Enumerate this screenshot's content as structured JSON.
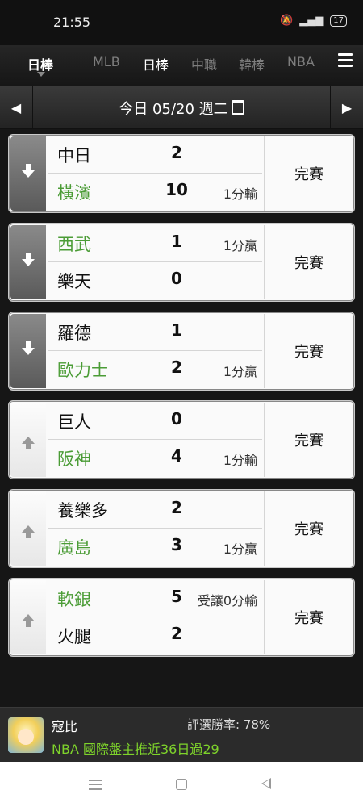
{
  "status_bar": {
    "time": "21:55",
    "battery": "17"
  },
  "league_tabs": {
    "current": "日棒",
    "items": [
      "MLB",
      "日棒",
      "中職",
      "韓棒",
      "NBA"
    ]
  },
  "date_bar": {
    "left_arrow": "◀",
    "right_arrow": "▶",
    "text": "今日 05/20 週二"
  },
  "games": [
    {
      "handle": "down",
      "home_team": "中日",
      "home_score": "2",
      "home_note": "",
      "home_highlight": false,
      "away_team": "橫濱",
      "away_score": "10",
      "away_note": "1分輸",
      "away_highlight": true,
      "status": "完賽"
    },
    {
      "handle": "down",
      "home_team": "西武",
      "home_score": "1",
      "home_note": "1分贏",
      "home_highlight": true,
      "away_team": "樂天",
      "away_score": "0",
      "away_note": "",
      "away_highlight": false,
      "status": "完賽"
    },
    {
      "handle": "down",
      "home_team": "羅德",
      "home_score": "1",
      "home_note": "",
      "home_highlight": false,
      "away_team": "歐力士",
      "away_score": "2",
      "away_note": "1分贏",
      "away_highlight": true,
      "status": "完賽"
    },
    {
      "handle": "up",
      "home_team": "巨人",
      "home_score": "0",
      "home_note": "",
      "home_highlight": false,
      "away_team": "阪神",
      "away_score": "4",
      "away_note": "1分輸",
      "away_highlight": true,
      "status": "完賽"
    },
    {
      "handle": "up",
      "home_team": "養樂多",
      "home_score": "2",
      "home_note": "",
      "home_highlight": false,
      "away_team": "廣島",
      "away_score": "3",
      "away_note": "1分贏",
      "away_highlight": true,
      "status": "完賽"
    },
    {
      "handle": "up",
      "home_team": "軟銀",
      "home_score": "5",
      "home_note": "受讓0分輸",
      "home_highlight": true,
      "away_team": "火腿",
      "away_score": "2",
      "away_note": "",
      "away_highlight": false,
      "status": "完賽"
    }
  ],
  "ad": {
    "name": "寇比",
    "rate": "評選勝率: 78%",
    "line": "NBA 國際盤主推近36日過29"
  },
  "colors": {
    "highlight_green": "#4b9c36",
    "ad_green": "#7ed32b",
    "background": "#161616"
  }
}
